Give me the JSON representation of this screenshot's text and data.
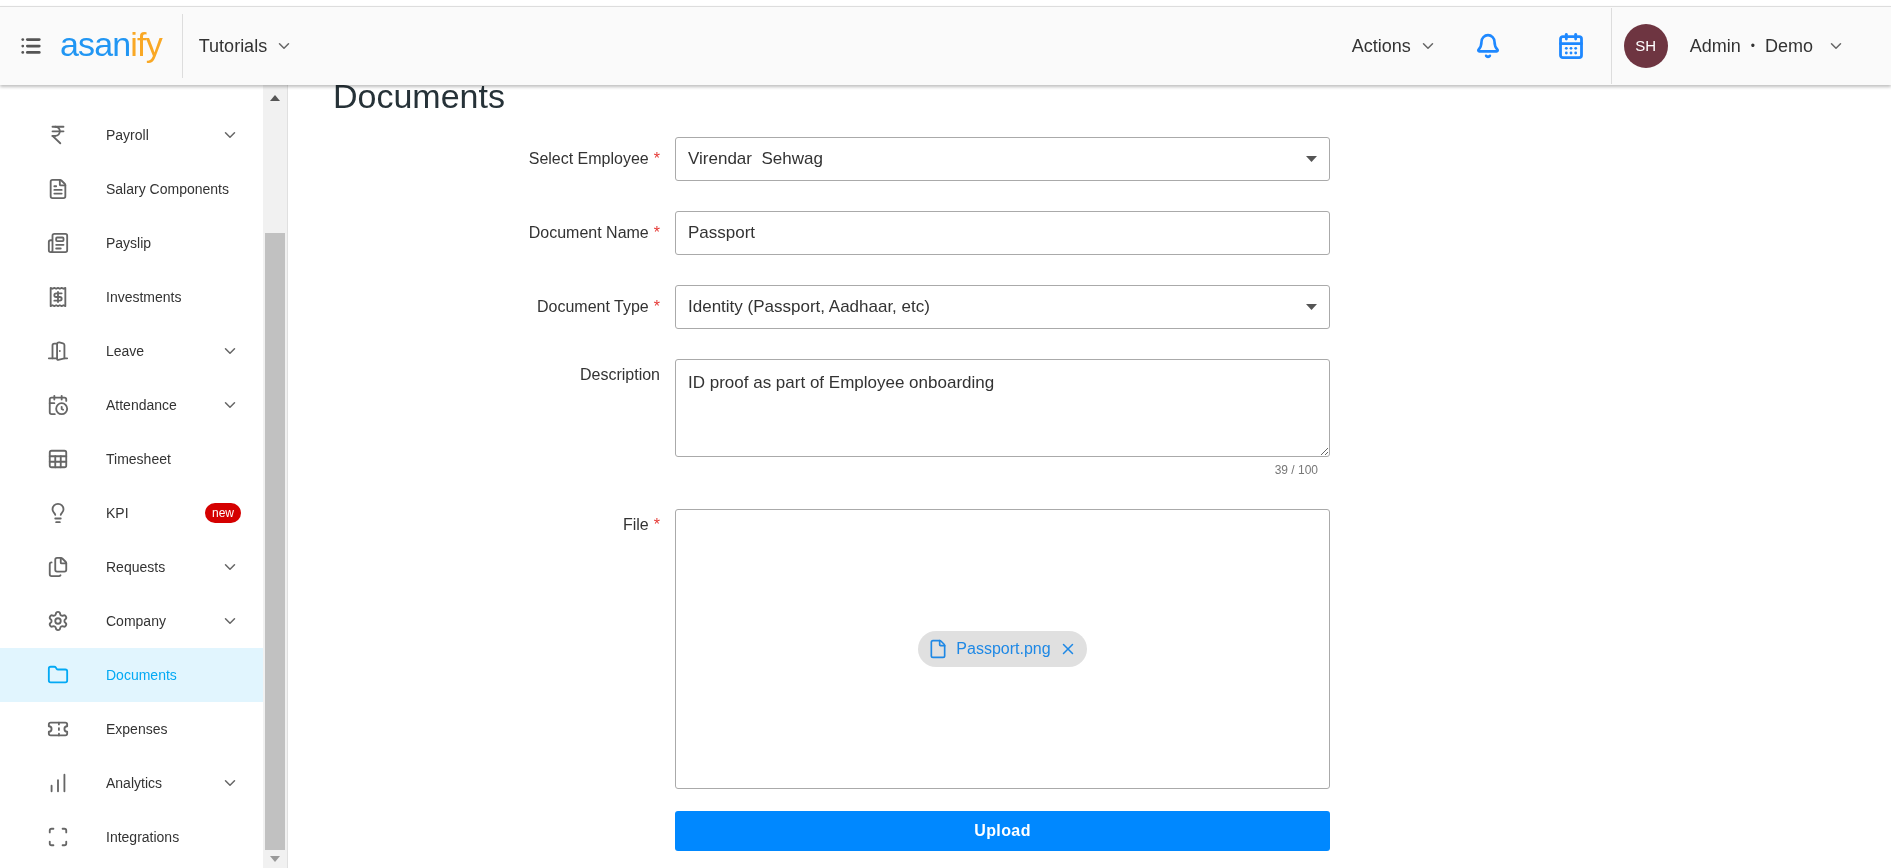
{
  "header": {
    "logo": [
      {
        "text": "asan",
        "color": "#2196f3"
      },
      {
        "text": "ify",
        "color": "#f9a825"
      }
    ],
    "tutorials": "Tutorials",
    "actions": "Actions",
    "avatar": "SH",
    "user": "Admin",
    "separator": "•",
    "company": "Demo"
  },
  "sidebar": {
    "items": [
      {
        "label": "Payroll",
        "expandable": true,
        "selected": false
      },
      {
        "label": "Salary Components",
        "expandable": false,
        "selected": false
      },
      {
        "label": "Payslip",
        "expandable": false,
        "selected": false
      },
      {
        "label": "Investments",
        "expandable": false,
        "selected": false
      },
      {
        "label": "Leave",
        "expandable": true,
        "selected": false
      },
      {
        "label": "Attendance",
        "expandable": true,
        "selected": false
      },
      {
        "label": "Timesheet",
        "expandable": false,
        "selected": false
      },
      {
        "label": "KPI",
        "expandable": false,
        "selected": false,
        "badge": "new"
      },
      {
        "label": "Requests",
        "expandable": true,
        "selected": false
      },
      {
        "label": "Company",
        "expandable": true,
        "selected": false
      },
      {
        "label": "Documents",
        "expandable": false,
        "selected": true
      },
      {
        "label": "Expenses",
        "expandable": false,
        "selected": false
      },
      {
        "label": "Analytics",
        "expandable": true,
        "selected": false
      },
      {
        "label": "Integrations",
        "expandable": false,
        "selected": false
      }
    ]
  },
  "page": {
    "title": "Documents",
    "fields": [
      {
        "kind": "select",
        "label": "Select Employee",
        "required_mark": "*",
        "value": "Virendar  Sehwag"
      },
      {
        "kind": "text",
        "label": "Document Name",
        "required_mark": "*",
        "value": "Passport"
      },
      {
        "kind": "select",
        "label": "Document Type",
        "required_mark": "*",
        "value": "Identity (Passport, Aadhaar, etc)"
      },
      {
        "kind": "textarea",
        "label": "Description",
        "value": "ID proof as part of Employee onboarding",
        "counter": "39 / 100"
      },
      {
        "kind": "file",
        "label": "File",
        "required_mark": "*",
        "file": "Passport.png"
      }
    ],
    "submit": "Upload"
  }
}
